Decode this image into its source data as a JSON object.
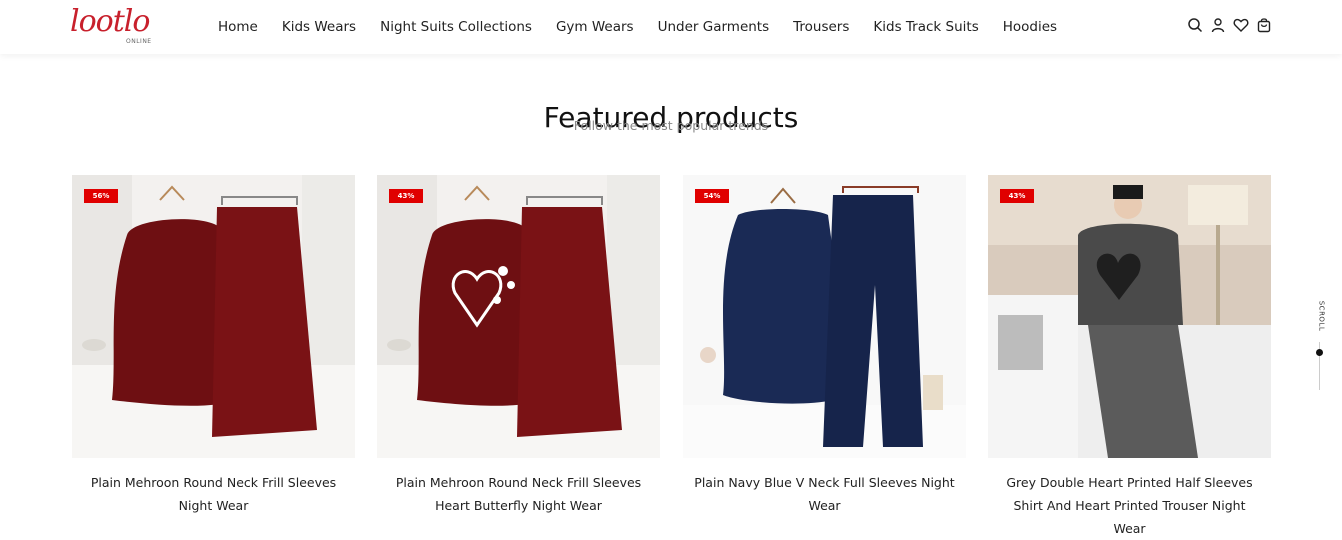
{
  "brand": {
    "logo_text": "lootlo",
    "logo_sub": "ONLINE",
    "accent": "#c8202c"
  },
  "nav": {
    "items": [
      {
        "label": "Home"
      },
      {
        "label": "Kids Wears"
      },
      {
        "label": "Night Suits Collections"
      },
      {
        "label": "Gym Wears"
      },
      {
        "label": "Under Garments"
      },
      {
        "label": "Trousers"
      },
      {
        "label": "Kids Track Suits"
      },
      {
        "label": "Hoodies"
      }
    ]
  },
  "header_icons": [
    "search-icon",
    "user-icon",
    "heart-icon",
    "cart-icon"
  ],
  "section": {
    "title": "Featured products",
    "subtitle": "Follow the most popular trends"
  },
  "products": [
    {
      "badge": "56%",
      "name": "Plain Mehroon Round Neck Frill Sleeves Night Wear"
    },
    {
      "badge": "43%",
      "name": "Plain Mehroon Round Neck Frill Sleeves Heart Butterfly Night Wear"
    },
    {
      "badge": "54%",
      "name": "Plain Navy Blue V Neck Full Sleeves Night Wear"
    },
    {
      "badge": "43%",
      "name": "Grey Double Heart Printed Half Sleeves Shirt And Heart Printed Trouser Night Wear"
    }
  ],
  "scroll_indicator": {
    "label": "SCROLL"
  },
  "colors": {
    "badge": "#e00000",
    "maroon": "#6e0f12",
    "navy": "#1a2a55",
    "grey": "#4a4a4a"
  }
}
